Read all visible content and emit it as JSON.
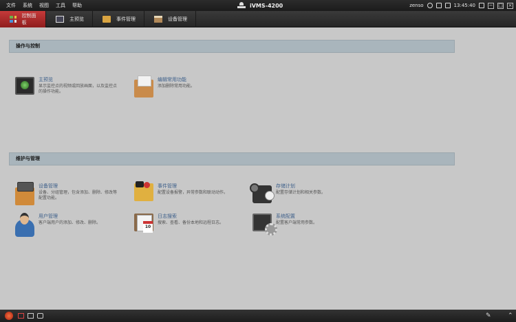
{
  "menubar": {
    "menus": [
      "文件",
      "系统",
      "视图",
      "工具",
      "帮助"
    ],
    "app_title": "iVMS-4200",
    "user": "zenso",
    "time": "13:45:40",
    "icons": [
      "globe-icon",
      "list-icon",
      "lock-icon",
      "minimize-icon",
      "restore-icon",
      "close-icon"
    ]
  },
  "tabs": [
    {
      "label": "控制面板",
      "icon": "control-panel-icon",
      "active": true
    },
    {
      "label": "主预览",
      "icon": "main-view-icon",
      "active": false
    },
    {
      "label": "事件管理",
      "icon": "event-folder-icon",
      "active": false
    },
    {
      "label": "设备管理",
      "icon": "device-box-icon",
      "active": false
    }
  ],
  "sections": {
    "operation": {
      "title": "操作与控制",
      "items": [
        {
          "title": "主预览",
          "desc": "显示监控点的视频或回放画面，以及监控点的操作功能。"
        },
        {
          "title": "编辑常用功能",
          "desc": "添加删除常用功能。"
        }
      ]
    },
    "maintenance": {
      "title": "维护与管理",
      "items": [
        {
          "title": "设备管理",
          "desc": "设备、分组管理，包含添加、删除、修改等配置功能。"
        },
        {
          "title": "事件管理",
          "desc": "配置设备报警，异常参数和联动动作。"
        },
        {
          "title": "存储计划",
          "desc": "配置存储计划和相关参数。"
        },
        {
          "title": "用户管理",
          "desc": "客户端用户的添加、修改、删除。"
        },
        {
          "title": "日志搜索",
          "desc": "搜索、查看、备份本地和远程日志。"
        },
        {
          "title": "系统配置",
          "desc": "配置客户端常用参数。"
        }
      ]
    }
  },
  "bottombar": {
    "icons": [
      "alarm-icon",
      "alarm-list-icon",
      "screen-icon",
      "sound-icon",
      "pin-icon",
      "expand-icon"
    ]
  },
  "colors": {
    "active_tab": "#b52a2a",
    "section_header": "#a9b5bc",
    "link_title": "#3d5f8a",
    "background": "#c8c8c8"
  }
}
